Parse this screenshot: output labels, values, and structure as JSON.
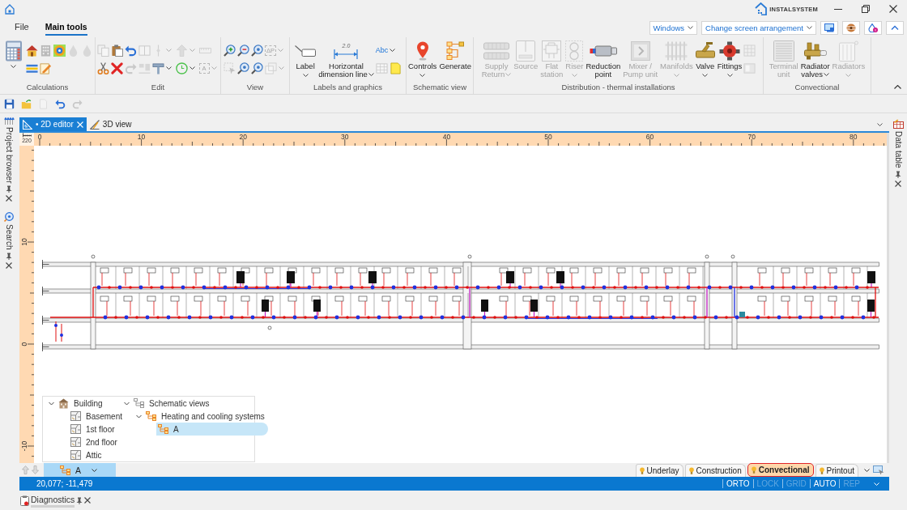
{
  "title_bar": {
    "brand": "INSTALSYSTEM"
  },
  "menu_tabs": [
    {
      "label": "File",
      "selected": false
    },
    {
      "label": "Main tools",
      "selected": true
    }
  ],
  "header_dropdowns": [
    {
      "value": "Windows"
    },
    {
      "value": "Change screen arrangement"
    }
  ],
  "ribbon": {
    "groups": [
      {
        "label": "Calculations",
        "large": [
          {
            "menu": true,
            "disabled": false
          }
        ],
        "small_rows": [
          [
            {
              "disabled": false,
              "menu": false,
              "on": false
            },
            {
              "disabled": false,
              "menu": false,
              "on": false
            },
            {
              "disabled": false,
              "menu": false,
              "on": true
            },
            {
              "disabled": true,
              "menu": false,
              "on": false
            },
            {
              "disabled": true,
              "menu": false,
              "on": false
            }
          ],
          [
            {
              "disabled": false,
              "menu": false,
              "on": false
            },
            {
              "disabled": false,
              "menu": false,
              "on": false
            }
          ]
        ]
      },
      {
        "label": "Edit",
        "small_rows": [
          [
            {
              "disabled": true,
              "menu": false,
              "on": false
            },
            {
              "disabled": false,
              "menu": false,
              "on": false
            },
            {
              "disabled": false,
              "menu": false,
              "on": false
            },
            {
              "disabled": true,
              "menu": false,
              "on": false
            },
            {
              "disabled": true,
              "menu": true,
              "on": false
            },
            {
              "disabled": true,
              "menu": true,
              "on": false
            },
            {
              "disabled": true,
              "menu": false,
              "on": false
            }
          ],
          [
            {
              "disabled": false,
              "menu": false,
              "on": false
            },
            {
              "disabled": false,
              "menu": false,
              "on": false
            },
            {
              "disabled": true,
              "menu": false,
              "on": false
            },
            {
              "disabled": true,
              "menu": false,
              "on": false
            },
            {
              "disabled": false,
              "menu": true,
              "on": false
            },
            {
              "disabled": false,
              "menu": true,
              "on": false
            },
            {
              "disabled": true,
              "menu": true,
              "on": false,
              "glyph": "A"
            }
          ]
        ]
      },
      {
        "label": "View",
        "small_rows": [
          [
            {
              "disabled": false,
              "menu": false,
              "on": false
            },
            {
              "disabled": false,
              "menu": false,
              "on": false
            },
            {
              "disabled": false,
              "menu": false,
              "on": false
            },
            {
              "disabled": true,
              "menu": true,
              "on": false,
              "glyph": "ΔP"
            }
          ],
          [
            {
              "disabled": true,
              "menu": false,
              "on": false
            },
            {
              "disabled": false,
              "menu": false,
              "on": false
            },
            {
              "disabled": false,
              "menu": false,
              "on": false
            },
            {
              "disabled": true,
              "menu": true,
              "on": false
            }
          ]
        ]
      },
      {
        "label": "Labels and graphics",
        "large": [
          {
            "lines": [
              "Label"
            ],
            "menu": true,
            "disabled": false
          },
          {
            "lines": [
              "Horizontal",
              "dimension line"
            ],
            "glyph": "2.0",
            "menu": true,
            "disabled": false
          }
        ],
        "small_rows": [
          [
            {
              "disabled": false,
              "menu": true,
              "on": false,
              "glyph": "Abc"
            }
          ],
          [
            {
              "disabled": true,
              "menu": false,
              "on": false
            },
            {
              "disabled": false,
              "menu": false,
              "on": false
            }
          ]
        ]
      },
      {
        "label": "Schematic view",
        "large": [
          {
            "lines": [
              "Controls"
            ],
            "menu": true,
            "disabled": false
          },
          {
            "lines": [
              "Generate"
            ],
            "menu": false,
            "disabled": false
          }
        ]
      },
      {
        "label": "Distribution - thermal installations",
        "large": [
          {
            "lines": [
              "Supply",
              "Return"
            ],
            "menu": true,
            "disabled": true
          },
          {
            "lines": [
              "Source"
            ],
            "menu": false,
            "disabled": true
          },
          {
            "lines": [
              "Flat",
              "station"
            ],
            "menu": false,
            "disabled": true
          },
          {
            "lines": [
              "Riser"
            ],
            "menu": true,
            "disabled": true
          },
          {
            "lines": [
              "Reduction",
              "point"
            ],
            "menu": false,
            "disabled": false
          },
          {
            "lines": [
              "Mixer /",
              "Pump unit"
            ],
            "menu": false,
            "disabled": true
          },
          {
            "lines": [
              "Manifolds"
            ],
            "menu": true,
            "disabled": true
          },
          {
            "lines": [
              "Valve"
            ],
            "menu": true,
            "disabled": false
          },
          {
            "lines": [
              "Fittings"
            ],
            "menu": true,
            "disabled": false
          }
        ],
        "small_rows": [
          [
            {
              "disabled": true,
              "menu": false,
              "on": false
            }
          ],
          [
            {
              "disabled": true,
              "menu": false,
              "on": false
            }
          ]
        ]
      },
      {
        "label": "Convectional",
        "large": [
          {
            "lines": [
              "Terminal",
              "unit"
            ],
            "menu": false,
            "disabled": true
          },
          {
            "lines": [
              "Radiator",
              "valves"
            ],
            "menu": true,
            "disabled": false
          },
          {
            "lines": [
              "Radiators"
            ],
            "menu": true,
            "disabled": true
          }
        ]
      }
    ]
  },
  "quick_access": [
    {
      "disabled": false
    },
    {
      "disabled": false
    },
    {
      "disabled": true
    },
    {
      "disabled": false
    },
    {
      "disabled": true
    }
  ],
  "side_panels": {
    "left": [
      {
        "label": "Project browser"
      },
      {
        "label": "Search"
      }
    ],
    "right": [
      {
        "label": "Data table"
      }
    ]
  },
  "document_tabs": [
    {
      "label": "• 2D editor",
      "selected": true
    },
    {
      "label": "3D view",
      "selected": false
    }
  ],
  "rulers": {
    "corner": "220",
    "x_labels": [
      "0",
      "10",
      "20",
      "30",
      "40",
      "50",
      "60",
      "70",
      "80"
    ],
    "y_labels": [
      "10",
      "0",
      "-10"
    ]
  },
  "project_tree": {
    "columns": [
      [
        {
          "label": "Building",
          "kind": "building",
          "expanded": true,
          "selected": false,
          "children": [
            {
              "label": "Basement",
              "kind": "floor",
              "selected": false
            },
            {
              "label": "1st floor",
              "kind": "floor",
              "selected": false
            },
            {
              "label": "2nd floor",
              "kind": "floor",
              "selected": false
            },
            {
              "label": "Attic",
              "kind": "floor",
              "selected": false
            }
          ]
        }
      ],
      [
        {
          "label": "Schematic views",
          "kind": "views",
          "expanded": true,
          "selected": false,
          "children": [
            {
              "label": "Heating and cooling systems",
              "kind": "system",
              "expanded": true,
              "selected": false,
              "children": [
                {
                  "label": "A",
                  "kind": "system",
                  "selected": true
                }
              ]
            }
          ]
        }
      ]
    ]
  },
  "view_selector": {
    "value": "A"
  },
  "layer_tabs": [
    {
      "label": "Underlay",
      "selected": false
    },
    {
      "label": "Construction",
      "selected": false
    },
    {
      "label": "Convectional",
      "selected": true
    },
    {
      "label": "Printout",
      "selected": false
    }
  ],
  "status_bar": {
    "coordinates": "20,077; -11,479",
    "toggles": [
      {
        "label": "ORTO",
        "on": true
      },
      {
        "label": "LOCK",
        "on": false
      },
      {
        "label": "GRID",
        "on": false
      },
      {
        "label": "AUTO",
        "on": true
      },
      {
        "label": "REP",
        "on": false
      }
    ]
  },
  "bottom_panels": [
    {
      "label": "Diagnostics"
    }
  ]
}
